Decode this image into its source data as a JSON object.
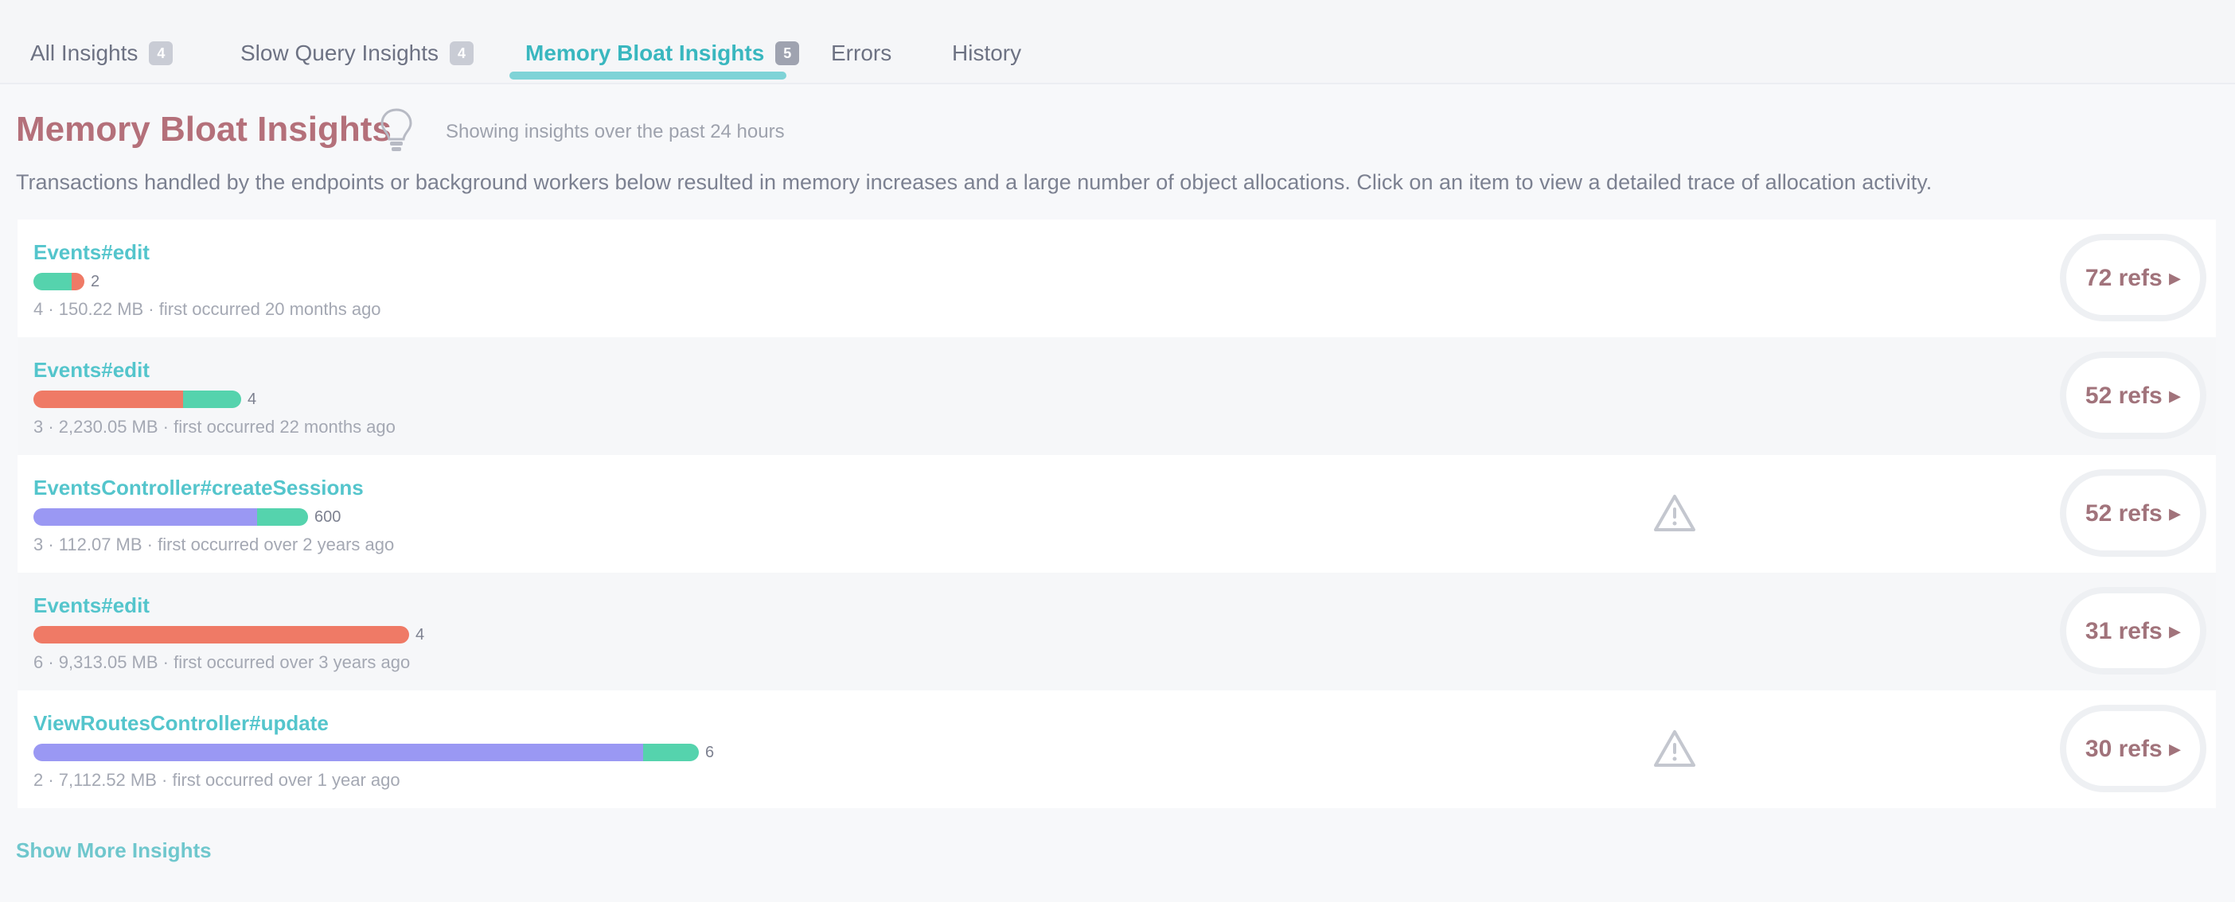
{
  "tabs": [
    {
      "label": "All Insights",
      "count": "4"
    },
    {
      "label": "Slow Query Insights",
      "count": "4"
    },
    {
      "label": "Memory Bloat Insights",
      "count": "5"
    },
    {
      "label": "Errors",
      "count": ""
    },
    {
      "label": "History",
      "count": ""
    }
  ],
  "header": {
    "title": "Memory Bloat Insights",
    "subtitle": "Showing insights over the past 24 hours",
    "description": "Transactions handled by the endpoints or background workers below resulted in memory increases and a large number of object allocations. Click on an item to view a detailed trace of allocation activity."
  },
  "colors": {
    "teal": "#55d3ad",
    "red": "#ef7a66",
    "purple": "#9a98f3",
    "link": "#54c5cc",
    "pill_text": "#a1737b"
  },
  "rows": [
    {
      "name": "Events#edit",
      "meta": "4 · 150.22 MB · first occurred 20 months ago",
      "pill": "72 refs ▸",
      "bar_value": "2",
      "warning": false,
      "segments": [
        {
          "color": "#55d3ad",
          "fraction": 0.075
        },
        {
          "color": "#ef7a66",
          "fraction": 0.025
        }
      ]
    },
    {
      "name": "Events#edit",
      "meta": "3 · 2,230.05 MB · first occurred 22 months ago",
      "pill": "52 refs ▸",
      "bar_value": "4",
      "warning": false,
      "segments": [
        {
          "color": "#ef7a66",
          "fraction": 0.295
        },
        {
          "color": "#55d3ad",
          "fraction": 0.115
        }
      ]
    },
    {
      "name": "EventsController#createSessions",
      "meta": "3 · 112.07 MB · first occurred over 2 years ago",
      "pill": "52 refs ▸",
      "bar_value": "600",
      "warning": true,
      "segments": [
        {
          "color": "#9a98f3",
          "fraction": 0.44
        },
        {
          "color": "#55d3ad",
          "fraction": 0.1
        }
      ]
    },
    {
      "name": "Events#edit",
      "meta": "6 · 9,313.05 MB · first occurred over 3 years ago",
      "pill": "31 refs ▸",
      "bar_value": "4",
      "warning": false,
      "segments": [
        {
          "color": "#ef7a66",
          "fraction": 0.74
        }
      ]
    },
    {
      "name": "ViewRoutesController#update",
      "meta": "2 · 7,112.52 MB · first occurred over 1 year ago",
      "pill": "30 refs ▸",
      "bar_value": "6",
      "warning": true,
      "segments": [
        {
          "color": "#9a98f3",
          "fraction": 1.2
        },
        {
          "color": "#55d3ad",
          "fraction": 0.11
        }
      ]
    }
  ],
  "footer": {
    "link": "Show More Insights"
  }
}
